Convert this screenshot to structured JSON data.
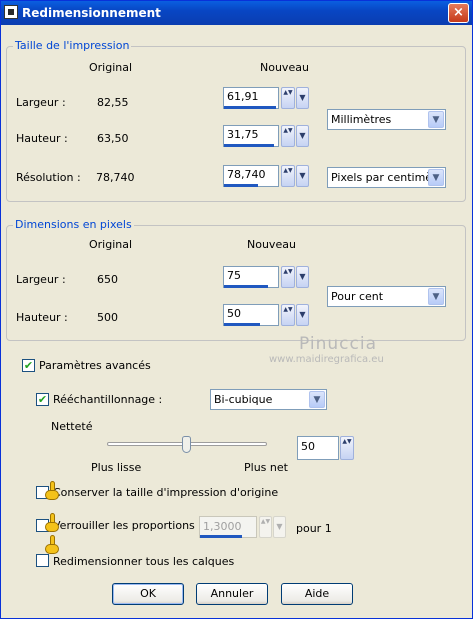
{
  "window": {
    "title": "Redimensionnement",
    "close_glyph": "×"
  },
  "print_size": {
    "title": "Taille de l'impression",
    "col_original": "Original",
    "col_new": "Nouveau",
    "width_label": "Largeur :",
    "width_original": "82,55",
    "width_new": "61,91",
    "height_label": "Hauteur :",
    "height_original": "63,50",
    "height_new": "31,75",
    "resolution_label": "Résolution :",
    "resolution_original": "78,740",
    "resolution_new": "78,740",
    "unit_select": "Millimètres",
    "resolution_unit_select": "Pixels par centimètre"
  },
  "pixel_dims": {
    "title": "Dimensions en pixels",
    "col_original": "Original",
    "col_new": "Nouveau",
    "width_label": "Largeur :",
    "width_original": "650",
    "width_new": "75",
    "height_label": "Hauteur :",
    "height_original": "500",
    "height_new": "50",
    "unit_select": "Pour cent"
  },
  "watermark": {
    "name": "Pinuccia",
    "url": "www.maidiregrafica.eu"
  },
  "advanced": {
    "label": "Paramètres avancés",
    "checked": true,
    "resample_label": "Rééchantillonnage :",
    "resample_checked": true,
    "resample_method": "Bi-cubique",
    "sharpness_label": "Netteté",
    "sharpness_value": "50",
    "sharpness_level": 50,
    "slider_min_label": "Plus lisse",
    "slider_max_label": "Plus net",
    "keep_print_size_label": "Conserver la taille d'impression d'origine",
    "lock_ratio_label": "Verrouiller les proportions :",
    "lock_ratio_value": "1,3000",
    "ratio_suffix": "pour 1",
    "resize_all_layers_label": "Redimensionner tous les calques"
  },
  "buttons": {
    "ok": "OK",
    "cancel": "Annuler",
    "help": "Aide"
  },
  "glyphs": {
    "check": "✔",
    "updown": "▲▼",
    "dropdown": "▼"
  }
}
